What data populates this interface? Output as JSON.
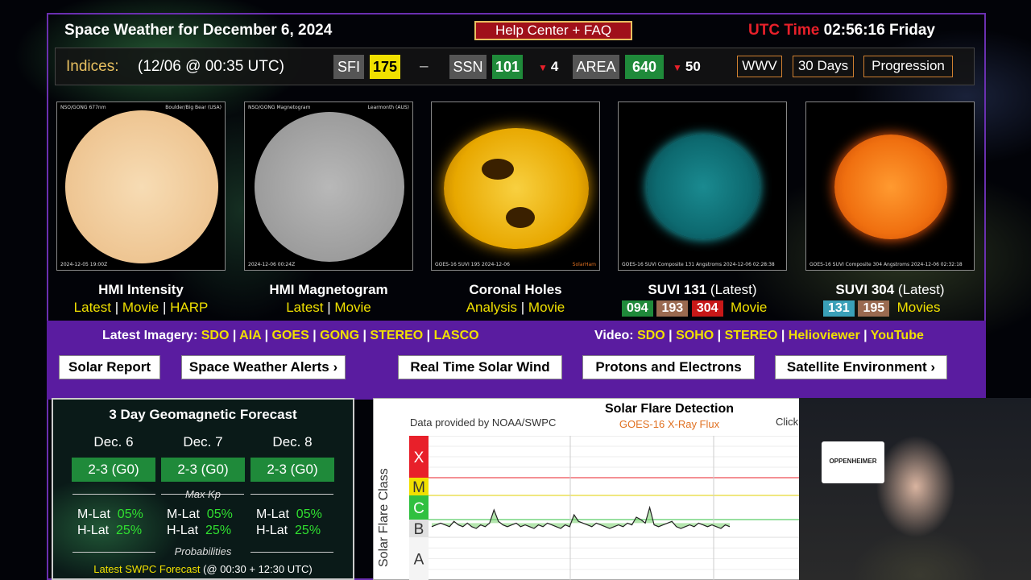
{
  "header": {
    "title": "Space Weather for December 6, 2024",
    "help_button": "Help Center + FAQ",
    "utc_label": "UTC Time",
    "utc_value": "02:56:16 Friday"
  },
  "indices": {
    "label": "Indices:",
    "timestamp": "(12/06 @ 00:35 UTC)",
    "sfi_label": "SFI",
    "sfi_value": "175",
    "sfi_change": "–",
    "ssn_label": "SSN",
    "ssn_value": "101",
    "ssn_change": "4",
    "area_label": "AREA",
    "area_value": "640",
    "area_change": "50",
    "buttons": [
      "WWV",
      "30 Days",
      "Progression"
    ]
  },
  "panels": [
    {
      "caption": "HMI Intensity",
      "links": [
        "Latest",
        "Movie",
        "HARP"
      ]
    },
    {
      "caption": "HMI Magnetogram",
      "links": [
        "Latest",
        "Movie"
      ]
    },
    {
      "caption": "Coronal Holes",
      "links": [
        "Analysis",
        "Movie"
      ]
    },
    {
      "caption": "SUVI 131",
      "caption_suffix": "(Latest)",
      "tags": [
        "094",
        "193",
        "304"
      ],
      "links": [
        "Movie"
      ]
    },
    {
      "caption": "SUVI 304",
      "caption_suffix": "(Latest)",
      "tags": [
        "131",
        "195"
      ],
      "links": [
        "Movies"
      ]
    }
  ],
  "panel_labels": {
    "p1_tl": "NSO/GONG 677nm",
    "p1_tr": "Boulder/Big Bear (USA)",
    "p1_bl": "2024-12-05 19:00Z",
    "p2_tl": "NSO/GONG Magnetogram",
    "p2_tr": "Learmonth (AUS)",
    "p2_bl": "2024-12-06 00:24Z",
    "p3_bl": "GOES-16 SUVI 195 2024-12-06",
    "p3_br": "SolarHam",
    "p4_bl": "GOES-16 SUVI Composite 131 Angstroms 2024-12-06 02:28:38",
    "p5_bl": "GOES-16 SUVI Composite 304 Angstroms 2024-12-06 02:32:18"
  },
  "imagery": {
    "label": "Latest Imagery:",
    "links": [
      "SDO",
      "AIA",
      "GOES",
      "GONG",
      "STEREO",
      "LASCO"
    ]
  },
  "video": {
    "label": "Video:",
    "links": [
      "SDO",
      "SOHO",
      "STEREO",
      "Helioviewer",
      "YouTube"
    ]
  },
  "nav_buttons": [
    "Solar Report",
    "Space Weather Alerts ›",
    "Real Time Solar Wind",
    "Protons and Electrons",
    "Satellite Environment ›"
  ],
  "geomagnetic": {
    "title": "3 Day Geomagnetic Forecast",
    "days": [
      {
        "date": "Dec. 6",
        "level": "2-3 (G0)",
        "mlat": "05%",
        "hlat": "25%"
      },
      {
        "date": "Dec. 7",
        "level": "2-3 (G0)",
        "mlat": "05%",
        "hlat": "25%"
      },
      {
        "date": "Dec. 8",
        "level": "2-3 (G0)",
        "mlat": "05%",
        "hlat": "25%"
      }
    ],
    "max_kp": "Max Kp",
    "mlat_label": "M-Lat",
    "hlat_label": "H-Lat",
    "probabilities": "Probabilities",
    "footer_link": "Latest SWPC Forecast",
    "footer_time": "(@ 00:30 + 12:30 UTC)"
  },
  "flare": {
    "title": "Solar Flare Detection",
    "subtitle": "GOES-16 X-Ray Flux",
    "provider": "Data provided by NOAA/SWPC",
    "click": "Click",
    "ylabel": "Solar Flare Class",
    "classes": [
      "X",
      "M",
      "C",
      "B",
      "A"
    ],
    "class_colors": [
      "#e8202a",
      "#f0e000",
      "#30c040",
      "#e0e0e0",
      "#f4f4f4"
    ],
    "class_text_colors": [
      "#ffffff",
      "#333333",
      "#ffffff",
      "#333333",
      "#333333"
    ]
  },
  "chart_data": {
    "type": "line",
    "title": "Solar Flare Detection",
    "subtitle": "GOES-16 X-Ray Flux",
    "ylabel": "Solar Flare Class",
    "y_scale": "log",
    "y_classes": [
      "A",
      "B",
      "C",
      "M",
      "X"
    ],
    "series": [
      {
        "values": [
          1.6,
          1.7,
          1.8,
          1.7,
          1.6,
          1.9,
          1.7,
          1.6,
          1.8,
          1.6,
          1.5,
          1.7,
          1.6,
          1.8,
          2.4,
          1.9,
          1.7,
          1.6,
          1.7,
          1.8,
          1.6,
          1.7,
          1.6,
          1.5,
          1.7,
          1.6,
          1.8,
          1.7,
          1.6,
          1.5,
          1.7,
          1.6,
          2.2,
          1.9,
          1.8,
          1.7,
          1.6,
          1.8,
          1.7,
          1.6,
          1.5,
          1.6,
          1.7,
          1.6,
          1.8,
          1.7,
          2.1,
          2.0,
          1.8,
          2.5,
          1.7,
          1.6,
          1.7,
          1.8,
          1.9,
          1.6,
          1.5,
          1.6,
          1.7,
          1.6,
          1.8,
          1.7,
          1.6,
          1.7,
          1.6,
          1.5,
          1.7,
          1.6
        ]
      }
    ],
    "grid": true
  }
}
